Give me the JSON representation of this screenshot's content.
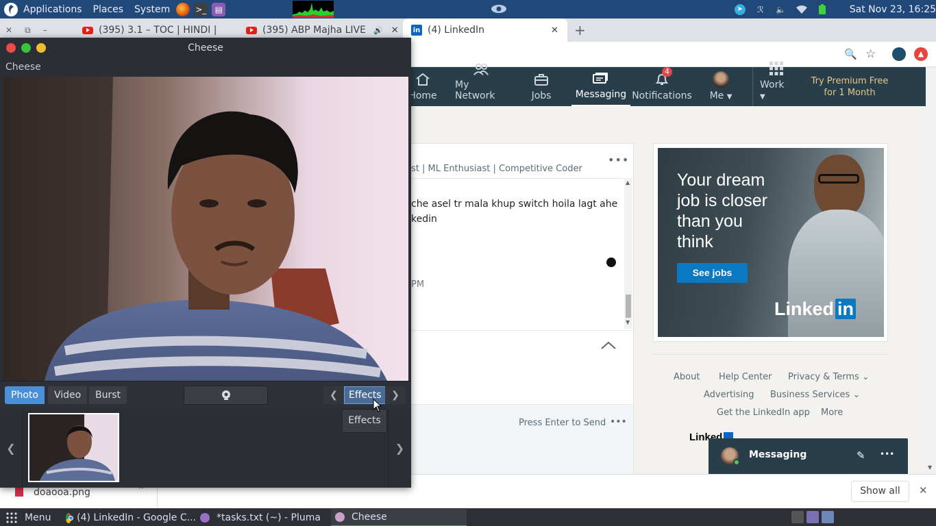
{
  "top_panel": {
    "menus": [
      "Applications",
      "Places",
      "System"
    ],
    "clock": "Sat Nov 23, 16:25",
    "icons": [
      "firefox-icon",
      "terminal-icon",
      "text-editor-icon"
    ],
    "tray_icons": [
      "telegram-icon",
      "bluetooth-icon",
      "volume-icon",
      "wifi-icon",
      "battery-icon"
    ]
  },
  "browser": {
    "tabs": [
      {
        "title": "(395) 3.1 – TOC | HINDI |"
      },
      {
        "title": "(395) ABP Majha LIVE"
      },
      {
        "title": "(4) LinkedIn"
      }
    ]
  },
  "linkedin": {
    "nav": {
      "home": "Home",
      "network": "My Network",
      "jobs": "Jobs",
      "messaging": "Messaging",
      "notifications": "Notifications",
      "notifications_count": "4",
      "me": "Me",
      "work": "Work",
      "premium_line1": "Try Premium Free",
      "premium_line2": "for 1 Month"
    },
    "conversation": {
      "headline": "st | ML Enthusiast | Competitive Coder",
      "message_line1": "che asel tr mala khup switch hoila lagt ahe",
      "message_line2": "kedin",
      "time": "PM",
      "press_enter": "Press Enter to Send"
    },
    "ad": {
      "headline_lines": [
        "Your dream",
        "job is closer",
        "than you",
        "think"
      ],
      "cta": "See jobs",
      "logo_text": "Linked",
      "logo_in": "in"
    },
    "footer": {
      "about": "About",
      "help": "Help Center",
      "privacy": "Privacy & Terms",
      "advertising": "Advertising",
      "business": "Business Services",
      "app": "Get the LinkedIn app",
      "more": "More",
      "brand": "Linked"
    },
    "messaging_bar": {
      "label": "Messaging"
    }
  },
  "download_bar": {
    "filename": "doaooa.png",
    "show_all": "Show all"
  },
  "cheese": {
    "title": "Cheese",
    "menu_label": "Cheese",
    "modes": [
      "Photo",
      "Video",
      "Burst"
    ],
    "active_mode": "Photo",
    "effects": "Effects",
    "effects_popup": "Effects"
  },
  "taskbar": {
    "menu": "Menu",
    "tasks": [
      {
        "title": "(4) LinkedIn - Google C..."
      },
      {
        "title": "*tasks.txt (~) - Pluma"
      },
      {
        "title": "Cheese"
      }
    ]
  },
  "colors": {
    "panel_blue": "#20497a",
    "linkedin_nav": "#283e4a",
    "linkedin_blue": "#0a66c2",
    "cheese_bg": "#2b2e35",
    "photo_active": "#4a90d9"
  }
}
